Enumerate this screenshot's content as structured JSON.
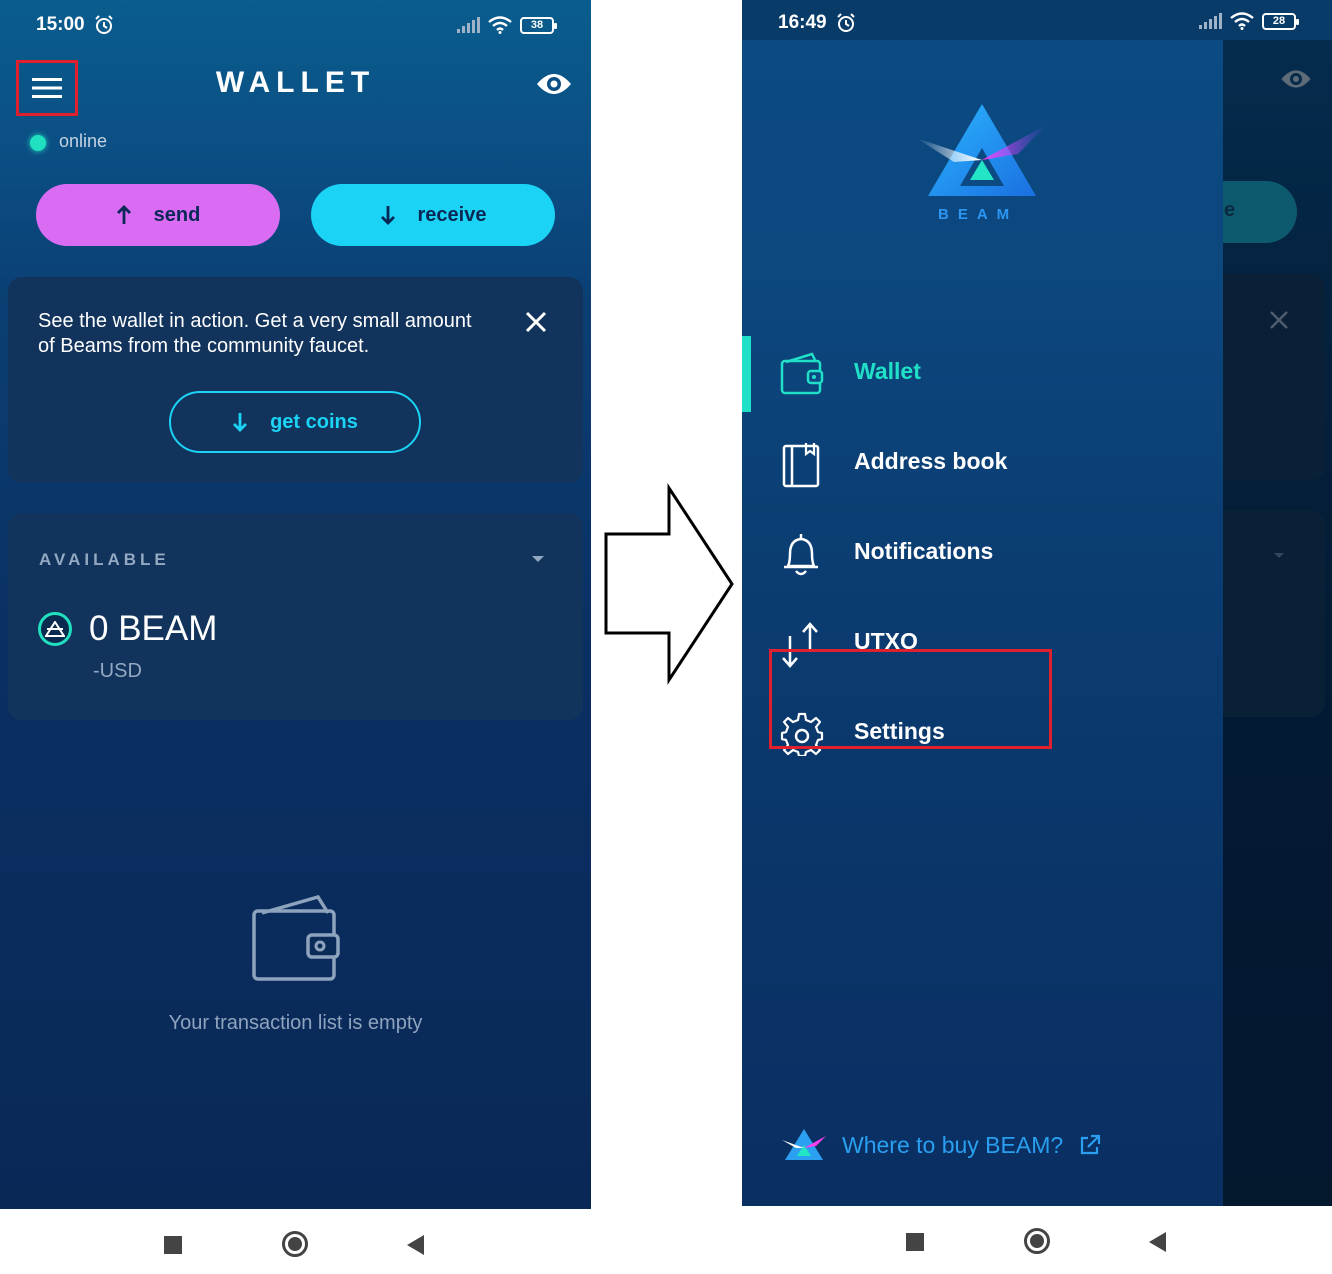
{
  "left": {
    "status_time": "15:00",
    "battery": "38",
    "title": "WALLET",
    "status": "online",
    "send_label": "send",
    "receive_label": "receive",
    "faucet_text": "See the wallet in action. Get a very small amount of Beams from the community faucet.",
    "get_coins_label": "get coins",
    "available_label": "AVAILABLE",
    "balance": "0 BEAM",
    "balance_usd": "-USD",
    "empty_text": "Your transaction list is empty"
  },
  "right": {
    "status_time": "16:49",
    "battery": "28",
    "logo_text": "BEAM",
    "receive_partial": "e",
    "menu": [
      {
        "label": "Wallet",
        "icon": "wallet-icon",
        "active": true
      },
      {
        "label": "Address book",
        "icon": "address-book-icon",
        "active": false
      },
      {
        "label": "Notifications",
        "icon": "bell-icon",
        "active": false
      },
      {
        "label": "UTXO",
        "icon": "utxo-arrows-icon",
        "active": false
      },
      {
        "label": "Settings",
        "icon": "gear-icon",
        "active": false
      }
    ],
    "buy_link": "Where to buy BEAM?"
  },
  "colors": {
    "send": "#d96cf3",
    "receive": "#1bd3f5",
    "accent": "#20e0c8",
    "highlight": "#e0202c",
    "link": "#2a9ff0"
  }
}
